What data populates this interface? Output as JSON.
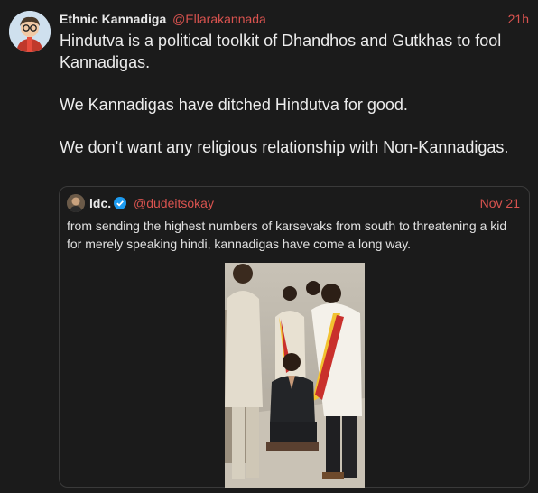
{
  "tweet": {
    "author_name": "Ethnic Kannadiga",
    "author_handle": "@Ellarakannada",
    "timestamp": "21h",
    "paragraphs": [
      "Hindutva is a political toolkit of Dhandhos and Gutkhas to fool Kannadigas.",
      "We Kannadigas have ditched Hindutva for good.",
      "We don't want any religious relationship with Non-Kannadigas."
    ]
  },
  "quote": {
    "author_name": "ldc.",
    "author_handle": "@dudeitsokay",
    "timestamp": "Nov 21",
    "verified_icon": "verified-badge-icon",
    "text": "from sending the highest numbers of karsevaks from south to threatening a kid for merely speaking hindi, kannadigas have come a long way."
  },
  "colors": {
    "background": "#1b1b1b",
    "accent": "#d9534f",
    "verified": "#1d9bf0",
    "text": "#ececec"
  }
}
